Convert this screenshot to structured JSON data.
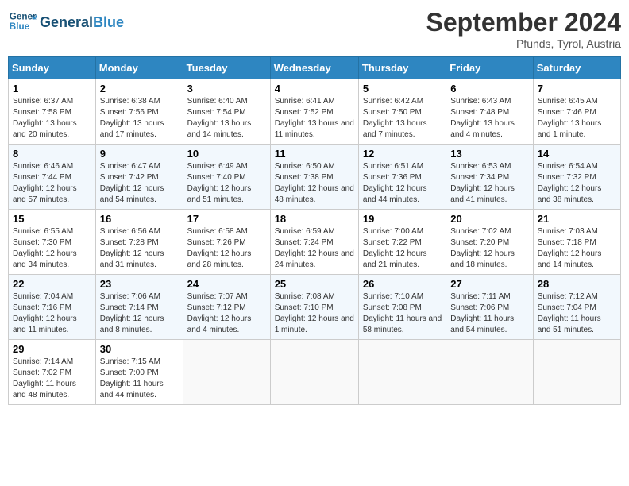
{
  "header": {
    "logo_general": "General",
    "logo_blue": "Blue",
    "month": "September 2024",
    "location": "Pfunds, Tyrol, Austria"
  },
  "days_of_week": [
    "Sunday",
    "Monday",
    "Tuesday",
    "Wednesday",
    "Thursday",
    "Friday",
    "Saturday"
  ],
  "weeks": [
    [
      {
        "day": "1",
        "sunrise": "6:37 AM",
        "sunset": "7:58 PM",
        "daylight": "13 hours and 20 minutes."
      },
      {
        "day": "2",
        "sunrise": "6:38 AM",
        "sunset": "7:56 PM",
        "daylight": "13 hours and 17 minutes."
      },
      {
        "day": "3",
        "sunrise": "6:40 AM",
        "sunset": "7:54 PM",
        "daylight": "13 hours and 14 minutes."
      },
      {
        "day": "4",
        "sunrise": "6:41 AM",
        "sunset": "7:52 PM",
        "daylight": "13 hours and 11 minutes."
      },
      {
        "day": "5",
        "sunrise": "6:42 AM",
        "sunset": "7:50 PM",
        "daylight": "13 hours and 7 minutes."
      },
      {
        "day": "6",
        "sunrise": "6:43 AM",
        "sunset": "7:48 PM",
        "daylight": "13 hours and 4 minutes."
      },
      {
        "day": "7",
        "sunrise": "6:45 AM",
        "sunset": "7:46 PM",
        "daylight": "13 hours and 1 minute."
      }
    ],
    [
      {
        "day": "8",
        "sunrise": "6:46 AM",
        "sunset": "7:44 PM",
        "daylight": "12 hours and 57 minutes."
      },
      {
        "day": "9",
        "sunrise": "6:47 AM",
        "sunset": "7:42 PM",
        "daylight": "12 hours and 54 minutes."
      },
      {
        "day": "10",
        "sunrise": "6:49 AM",
        "sunset": "7:40 PM",
        "daylight": "12 hours and 51 minutes."
      },
      {
        "day": "11",
        "sunrise": "6:50 AM",
        "sunset": "7:38 PM",
        "daylight": "12 hours and 48 minutes."
      },
      {
        "day": "12",
        "sunrise": "6:51 AM",
        "sunset": "7:36 PM",
        "daylight": "12 hours and 44 minutes."
      },
      {
        "day": "13",
        "sunrise": "6:53 AM",
        "sunset": "7:34 PM",
        "daylight": "12 hours and 41 minutes."
      },
      {
        "day": "14",
        "sunrise": "6:54 AM",
        "sunset": "7:32 PM",
        "daylight": "12 hours and 38 minutes."
      }
    ],
    [
      {
        "day": "15",
        "sunrise": "6:55 AM",
        "sunset": "7:30 PM",
        "daylight": "12 hours and 34 minutes."
      },
      {
        "day": "16",
        "sunrise": "6:56 AM",
        "sunset": "7:28 PM",
        "daylight": "12 hours and 31 minutes."
      },
      {
        "day": "17",
        "sunrise": "6:58 AM",
        "sunset": "7:26 PM",
        "daylight": "12 hours and 28 minutes."
      },
      {
        "day": "18",
        "sunrise": "6:59 AM",
        "sunset": "7:24 PM",
        "daylight": "12 hours and 24 minutes."
      },
      {
        "day": "19",
        "sunrise": "7:00 AM",
        "sunset": "7:22 PM",
        "daylight": "12 hours and 21 minutes."
      },
      {
        "day": "20",
        "sunrise": "7:02 AM",
        "sunset": "7:20 PM",
        "daylight": "12 hours and 18 minutes."
      },
      {
        "day": "21",
        "sunrise": "7:03 AM",
        "sunset": "7:18 PM",
        "daylight": "12 hours and 14 minutes."
      }
    ],
    [
      {
        "day": "22",
        "sunrise": "7:04 AM",
        "sunset": "7:16 PM",
        "daylight": "12 hours and 11 minutes."
      },
      {
        "day": "23",
        "sunrise": "7:06 AM",
        "sunset": "7:14 PM",
        "daylight": "12 hours and 8 minutes."
      },
      {
        "day": "24",
        "sunrise": "7:07 AM",
        "sunset": "7:12 PM",
        "daylight": "12 hours and 4 minutes."
      },
      {
        "day": "25",
        "sunrise": "7:08 AM",
        "sunset": "7:10 PM",
        "daylight": "12 hours and 1 minute."
      },
      {
        "day": "26",
        "sunrise": "7:10 AM",
        "sunset": "7:08 PM",
        "daylight": "11 hours and 58 minutes."
      },
      {
        "day": "27",
        "sunrise": "7:11 AM",
        "sunset": "7:06 PM",
        "daylight": "11 hours and 54 minutes."
      },
      {
        "day": "28",
        "sunrise": "7:12 AM",
        "sunset": "7:04 PM",
        "daylight": "11 hours and 51 minutes."
      }
    ],
    [
      {
        "day": "29",
        "sunrise": "7:14 AM",
        "sunset": "7:02 PM",
        "daylight": "11 hours and 48 minutes."
      },
      {
        "day": "30",
        "sunrise": "7:15 AM",
        "sunset": "7:00 PM",
        "daylight": "11 hours and 44 minutes."
      },
      null,
      null,
      null,
      null,
      null
    ]
  ],
  "labels": {
    "sunrise": "Sunrise:",
    "sunset": "Sunset:",
    "daylight": "Daylight:"
  }
}
